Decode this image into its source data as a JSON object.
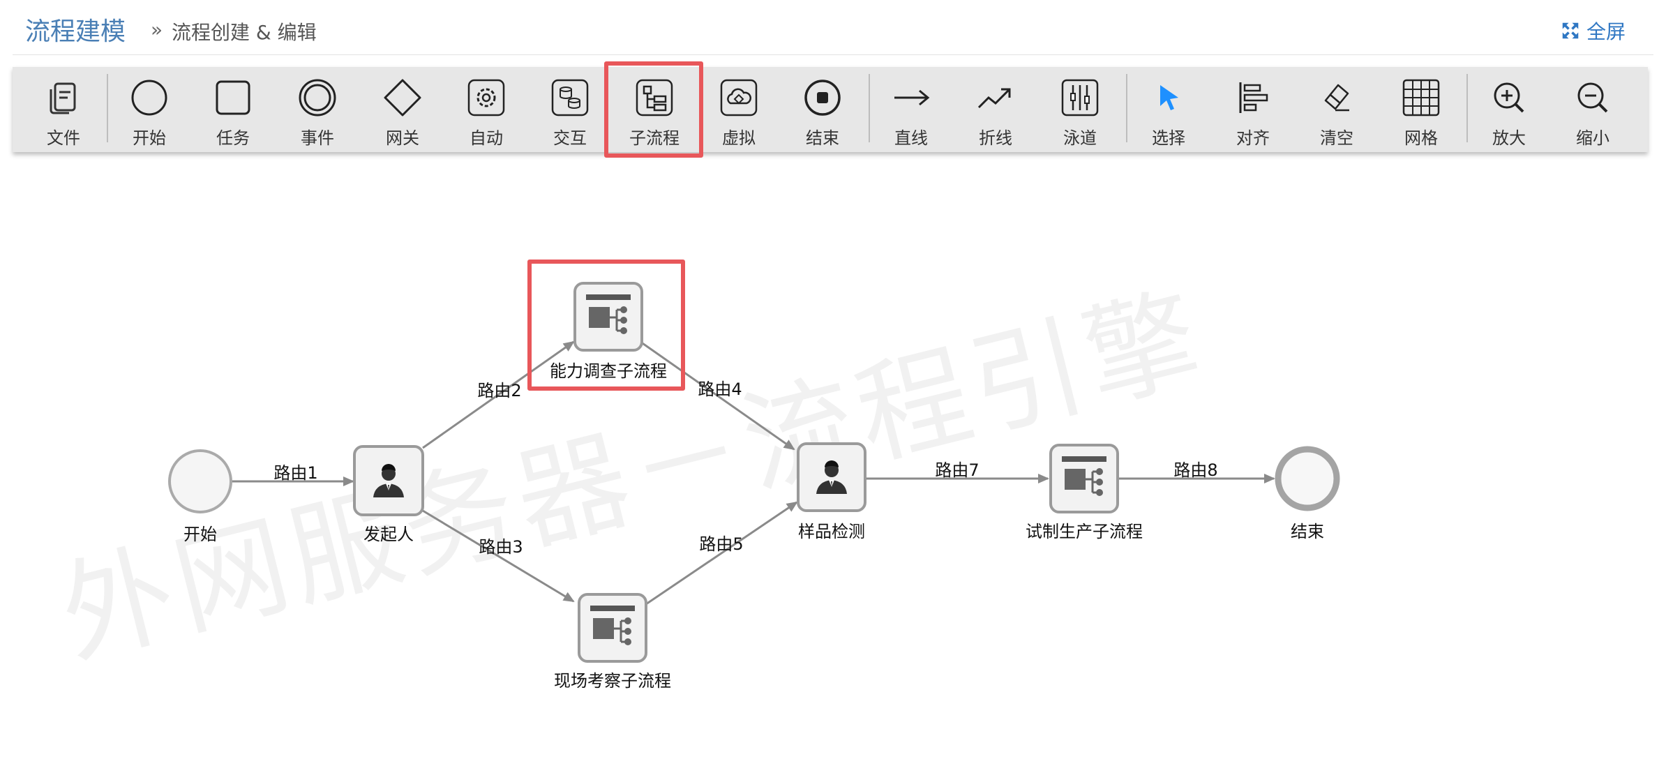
{
  "header": {
    "title": "流程建模",
    "separator": "»",
    "breadcrumb": "流程创建 & 编辑",
    "fullscreen_label": "全屏"
  },
  "toolbar": {
    "items": [
      {
        "label": "文件",
        "icon": "file-icon"
      },
      {
        "label": "开始",
        "icon": "start-circle-icon"
      },
      {
        "label": "任务",
        "icon": "task-square-icon"
      },
      {
        "label": "事件",
        "icon": "event-double-circle-icon"
      },
      {
        "label": "网关",
        "icon": "gateway-diamond-icon"
      },
      {
        "label": "自动",
        "icon": "auto-gear-icon"
      },
      {
        "label": "交互",
        "icon": "interaction-db-icon"
      },
      {
        "label": "子流程",
        "icon": "subprocess-icon"
      },
      {
        "label": "虚拟",
        "icon": "virtual-cloud-icon"
      },
      {
        "label": "结束",
        "icon": "end-stop-icon"
      },
      {
        "label": "直线",
        "icon": "straight-arrow-icon"
      },
      {
        "label": "折线",
        "icon": "polyline-arrow-icon"
      },
      {
        "label": "泳道",
        "icon": "swimlane-icon"
      },
      {
        "label": "选择",
        "icon": "select-cursor-icon"
      },
      {
        "label": "对齐",
        "icon": "align-icon"
      },
      {
        "label": "清空",
        "icon": "eraser-icon"
      },
      {
        "label": "网格",
        "icon": "grid-icon"
      },
      {
        "label": "放大",
        "icon": "zoom-in-icon"
      },
      {
        "label": "缩小",
        "icon": "zoom-out-icon"
      }
    ],
    "selected": "子流程"
  },
  "diagram": {
    "nodes": [
      {
        "id": "start",
        "label": "开始",
        "type": "start"
      },
      {
        "id": "initiator",
        "label": "发起人",
        "type": "user-task"
      },
      {
        "id": "capability",
        "label": "能力调查子流程",
        "type": "subprocess"
      },
      {
        "id": "site",
        "label": "现场考察子流程",
        "type": "subprocess"
      },
      {
        "id": "sample",
        "label": "样品检测",
        "type": "user-task"
      },
      {
        "id": "trial",
        "label": "试制生产子流程",
        "type": "subprocess"
      },
      {
        "id": "end",
        "label": "结束",
        "type": "end"
      }
    ],
    "edges": [
      {
        "label": "路由1",
        "from": "start",
        "to": "initiator"
      },
      {
        "label": "路由2",
        "from": "initiator",
        "to": "capability"
      },
      {
        "label": "路由3",
        "from": "initiator",
        "to": "site"
      },
      {
        "label": "路由4",
        "from": "capability",
        "to": "sample"
      },
      {
        "label": "路由5",
        "from": "site",
        "to": "sample"
      },
      {
        "label": "路由7",
        "from": "sample",
        "to": "trial"
      },
      {
        "label": "路由8",
        "from": "trial",
        "to": "end"
      }
    ],
    "highlighted_node": "能力调查子流程"
  },
  "watermark": "外网服务器－流程引擎",
  "colors": {
    "title": "#4a7fb5",
    "link": "#2f77c3",
    "highlight": "#e8575a",
    "toolbar_bg": "#e7e7e7",
    "select_icon": "#1e90ff"
  }
}
